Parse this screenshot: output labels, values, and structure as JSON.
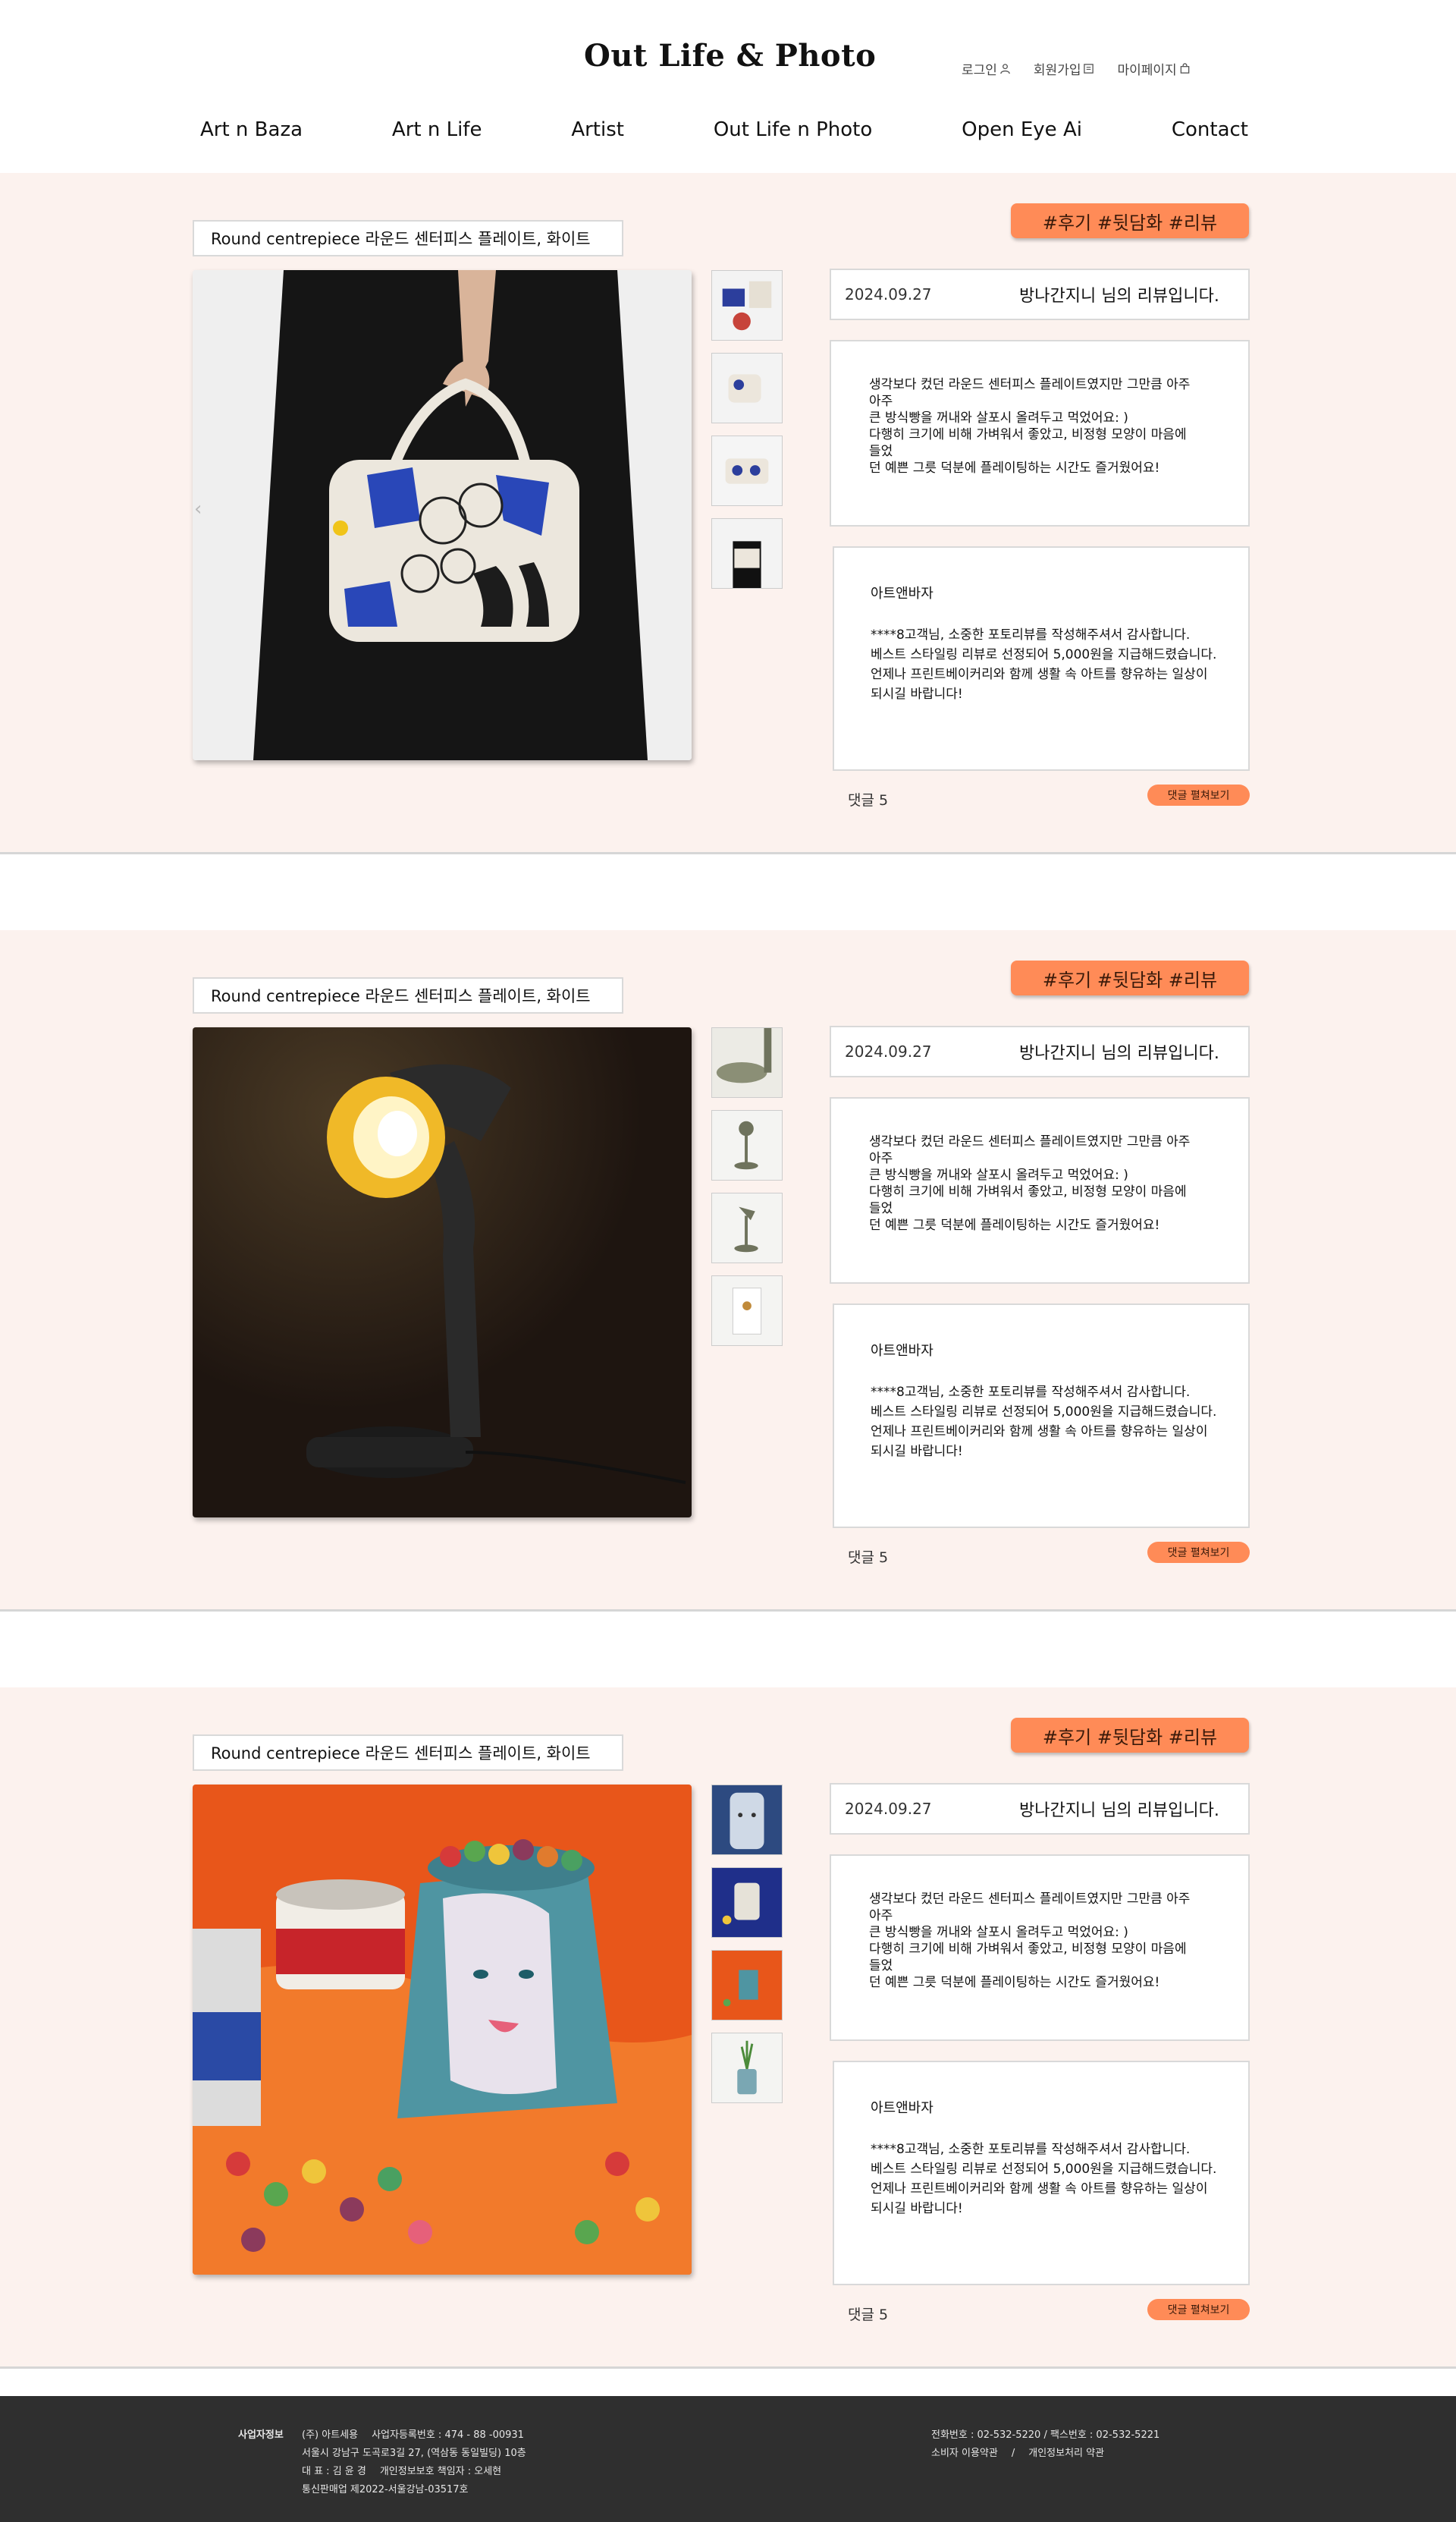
{
  "header": {
    "logo": "Out Life & Photo",
    "top_links": [
      {
        "label": "로그인",
        "icon": "user-icon"
      },
      {
        "label": "회원가입",
        "icon": "signup-icon"
      },
      {
        "label": "마이페이지",
        "icon": "bag-icon"
      }
    ],
    "nav": [
      "Art n Baza",
      "Art n Life",
      "Artist",
      "Out Life n Photo",
      "Open Eye Ai",
      "Contact"
    ]
  },
  "reviews": [
    {
      "product": "Round centrepiece 라운드 센터피스 플레이트, 화이트",
      "tags": "#후기 #뒷담화 #리뷰",
      "date": "2024.09.27",
      "reviewer": "방나간지니 님의 리뷰입니다.",
      "review_text": "생각보다 컸던 라운드 센터피스 플레이트였지만 그만큼 아주\n아주\n큰 방식빵을 꺼내와 살포시 올려두고 먹었어요: )\n다행히 크기에 비해 가벼워서 좋았고, 비정형 모양이 마음에\n들었\n던 예쁜 그릇 덕분에 플레이팅하는 시간도 즐거웠어요!",
      "reply_author": "아트앤바자",
      "reply_text": "****8고객님, 소중한 포토리뷰를 작성해주셔서 감사합니다.\n베스트 스타일링 리뷰로 선정되어 5,000원을 지급해드렸습니다.\n언제나 프린트베이커리와 함께 생활 속 아트를 향유하는 일상이\n되시길 바랍니다!",
      "comments": "댓글 5",
      "expand": "댓글 펼쳐보기",
      "image": "tote-bag-photo",
      "thumbs": [
        "tote-thumb-1",
        "tote-thumb-2",
        "tote-thumb-3",
        "tote-thumb-4"
      ]
    },
    {
      "product": "Round centrepiece 라운드 센터피스 플레이트, 화이트",
      "tags": "#후기 #뒷담화 #리뷰",
      "date": "2024.09.27",
      "reviewer": "방나간지니 님의 리뷰입니다.",
      "review_text": "생각보다 컸던 라운드 센터피스 플레이트였지만 그만큼 아주\n아주\n큰 방식빵을 꺼내와 살포시 올려두고 먹었어요: )\n다행히 크기에 비해 가벼워서 좋았고, 비정형 모양이 마음에\n들었\n던 예쁜 그릇 덕분에 플레이팅하는 시간도 즐거웠어요!",
      "reply_author": "아트앤바자",
      "reply_text": "****8고객님, 소중한 포토리뷰를 작성해주셔서 감사합니다.\n베스트 스타일링 리뷰로 선정되어 5,000원을 지급해드렸습니다.\n언제나 프린트베이커리와 함께 생활 속 아트를 향유하는 일상이\n되시길 바랍니다!",
      "comments": "댓글 5",
      "expand": "댓글 펼쳐보기",
      "image": "desk-lamp-photo",
      "thumbs": [
        "lamp-thumb-1",
        "lamp-thumb-2",
        "lamp-thumb-3",
        "lamp-thumb-4"
      ]
    },
    {
      "product": "Round centrepiece 라운드 센터피스 플레이트, 화이트",
      "tags": "#후기 #뒷담화 #리뷰",
      "date": "2024.09.27",
      "reviewer": "방나간지니 님의 리뷰입니다.",
      "review_text": "생각보다 컸던 라운드 센터피스 플레이트였지만 그만큼 아주\n아주\n큰 방식빵을 꺼내와 살포시 올려두고 먹었어요: )\n다행히 크기에 비해 가벼워서 좋았고, 비정형 모양이 마음에\n들었\n던 예쁜 그릇 덕분에 플레이팅하는 시간도 즐거웠어요!",
      "reply_author": "아트앤바자",
      "reply_text": "****8고객님, 소중한 포토리뷰를 작성해주셔서 감사합니다.\n베스트 스타일링 리뷰로 선정되어 5,000원을 지급해드렸습니다.\n언제나 프린트베이커리와 함께 생활 속 아트를 향유하는 일상이\n되시길 바랍니다!",
      "comments": "댓글 5",
      "expand": "댓글 펼쳐보기",
      "image": "face-vase-candy-photo",
      "thumbs": [
        "vase-thumb-1",
        "vase-thumb-2",
        "vase-thumb-3",
        "vase-thumb-4"
      ]
    }
  ],
  "footer": {
    "label": "사업자정보",
    "company_line": [
      "(주) 아트세용",
      "사업자등록번호 : 474 - 88 -00931"
    ],
    "address": "서울시 강남구 도곡로3길 27, (역삼동 동일빌딩) 10층",
    "ceo_line": [
      "대 표 : 김 윤 경",
      "개인정보보호 책임자 : 오세현"
    ],
    "registration": "통신판매업 제2022-서울강남-03517호",
    "contact": "전화번호 : 02-532-5220  /  팩스번호 : 02-532-5221",
    "links": [
      "소비자 이용약관",
      "개인정보처리 약관"
    ],
    "link_separator": "/"
  },
  "colors": {
    "accent": "#ff8b57",
    "section_bg": "#fcf2ee",
    "footer_bg": "#2f2f2f"
  }
}
